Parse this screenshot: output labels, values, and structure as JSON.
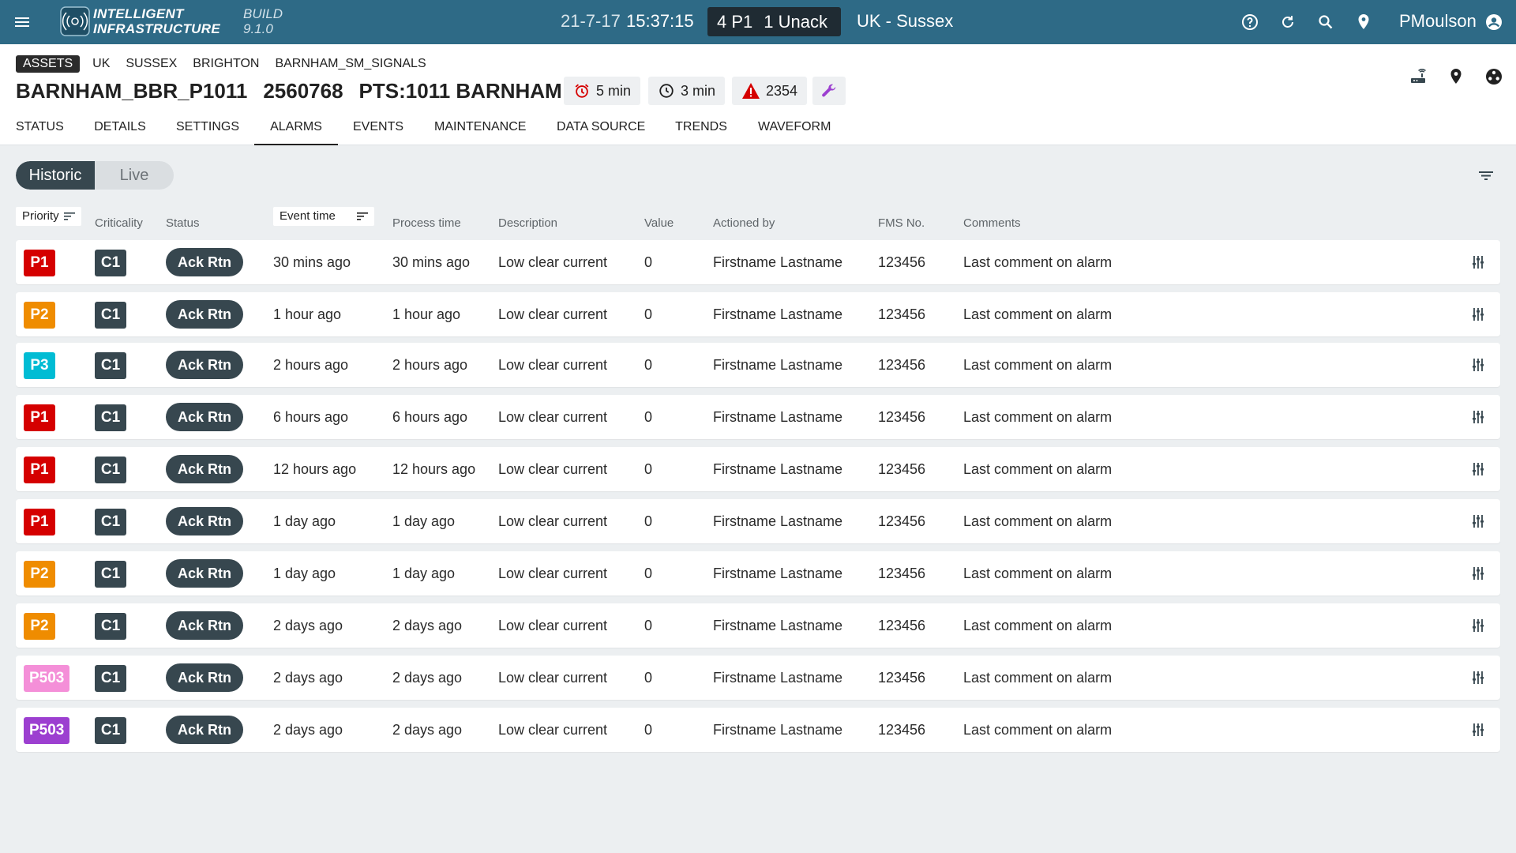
{
  "topbar": {
    "brand_line1": "INTELLIGENT",
    "brand_line2": "INFRASTRUCTURE",
    "build_label": "BUILD",
    "build_version": "9.1.0",
    "date": "21-7-17",
    "time": "15:37:15",
    "p1_count": "4 P1",
    "unack_count": "1 Unack",
    "region": "UK - Sussex",
    "username": "PMoulson",
    "color": "#2e6a86"
  },
  "breadcrumb": {
    "tag": "ASSETS",
    "items": [
      "UK",
      "SUSSEX",
      "BRIGHTON",
      "BARNHAM_SM_SIGNALS"
    ]
  },
  "asset": {
    "name": "BARNHAM_BBR_P1011",
    "id": "2560768",
    "pts": "PTS:1011 BARNHAM"
  },
  "stats": {
    "alarm_interval": "5 min",
    "clock_interval": "3 min",
    "warning_count": "2354"
  },
  "tabs": [
    "STATUS",
    "DETAILS",
    "SETTINGS",
    "ALARMS",
    "EVENTS",
    "MAINTENANCE",
    "DATA SOURCE",
    "TRENDS",
    "WAVEFORM"
  ],
  "active_tab": "ALARMS",
  "toggle": {
    "historic": "Historic",
    "live": "Live",
    "active": "Historic"
  },
  "columns": {
    "priority": "Priority",
    "criticality": "Criticality",
    "status": "Status",
    "event_time": "Event time",
    "process_time": "Process time",
    "description": "Description",
    "value": "Value",
    "actioned_by": "Actioned by",
    "fms_no": "FMS No.",
    "comments": "Comments"
  },
  "priority_colors": {
    "P1": "#d50000",
    "P2": "#ef8c00",
    "P3": "#00bcd4",
    "P503_pink": "#f48fd8",
    "P503_purple": "#9c3fd0"
  },
  "rows": [
    {
      "priority": "P1",
      "color": "#d50000",
      "criticality": "C1",
      "status": "Ack Rtn",
      "event_time": "30 mins ago",
      "process_time": "30 mins ago",
      "description": "Low clear current",
      "value": "0",
      "actioned_by": "Firstname Lastname",
      "fms_no": "123456",
      "comments": "Last comment on alarm"
    },
    {
      "priority": "P2",
      "color": "#ef8c00",
      "criticality": "C1",
      "status": "Ack Rtn",
      "event_time": "1 hour ago",
      "process_time": "1 hour ago",
      "description": "Low clear current",
      "value": "0",
      "actioned_by": "Firstname Lastname",
      "fms_no": "123456",
      "comments": "Last comment on alarm"
    },
    {
      "priority": "P3",
      "color": "#00bcd4",
      "criticality": "C1",
      "status": "Ack Rtn",
      "event_time": "2 hours ago",
      "process_time": "2 hours ago",
      "description": "Low clear current",
      "value": "0",
      "actioned_by": "Firstname Lastname",
      "fms_no": "123456",
      "comments": "Last comment on alarm"
    },
    {
      "priority": "P1",
      "color": "#d50000",
      "criticality": "C1",
      "status": "Ack Rtn",
      "event_time": "6 hours ago",
      "process_time": "6 hours ago",
      "description": "Low clear current",
      "value": "0",
      "actioned_by": "Firstname Lastname",
      "fms_no": "123456",
      "comments": "Last comment on alarm"
    },
    {
      "priority": "P1",
      "color": "#d50000",
      "criticality": "C1",
      "status": "Ack Rtn",
      "event_time": "12 hours ago",
      "process_time": "12 hours ago",
      "description": "Low clear current",
      "value": "0",
      "actioned_by": "Firstname Lastname",
      "fms_no": "123456",
      "comments": "Last comment on alarm"
    },
    {
      "priority": "P1",
      "color": "#d50000",
      "criticality": "C1",
      "status": "Ack Rtn",
      "event_time": "1 day ago",
      "process_time": "1 day ago",
      "description": "Low clear current",
      "value": "0",
      "actioned_by": "Firstname Lastname",
      "fms_no": "123456",
      "comments": "Last comment on alarm"
    },
    {
      "priority": "P2",
      "color": "#ef8c00",
      "criticality": "C1",
      "status": "Ack Rtn",
      "event_time": "1 day ago",
      "process_time": "1 day ago",
      "description": "Low clear current",
      "value": "0",
      "actioned_by": "Firstname Lastname",
      "fms_no": "123456",
      "comments": "Last comment on alarm"
    },
    {
      "priority": "P2",
      "color": "#ef8c00",
      "criticality": "C1",
      "status": "Ack Rtn",
      "event_time": "2 days ago",
      "process_time": "2 days ago",
      "description": "Low clear current",
      "value": "0",
      "actioned_by": "Firstname Lastname",
      "fms_no": "123456",
      "comments": "Last comment on alarm"
    },
    {
      "priority": "P503",
      "color": "#f48fd8",
      "criticality": "C1",
      "status": "Ack Rtn",
      "event_time": "2 days ago",
      "process_time": "2 days ago",
      "description": "Low clear current",
      "value": "0",
      "actioned_by": "Firstname Lastname",
      "fms_no": "123456",
      "comments": "Last comment on alarm"
    },
    {
      "priority": "P503",
      "color": "#9c3fd0",
      "criticality": "C1",
      "status": "Ack Rtn",
      "event_time": "2 days ago",
      "process_time": "2 days ago",
      "description": "Low clear current",
      "value": "0",
      "actioned_by": "Firstname Lastname",
      "fms_no": "123456",
      "comments": "Last comment on alarm"
    }
  ]
}
